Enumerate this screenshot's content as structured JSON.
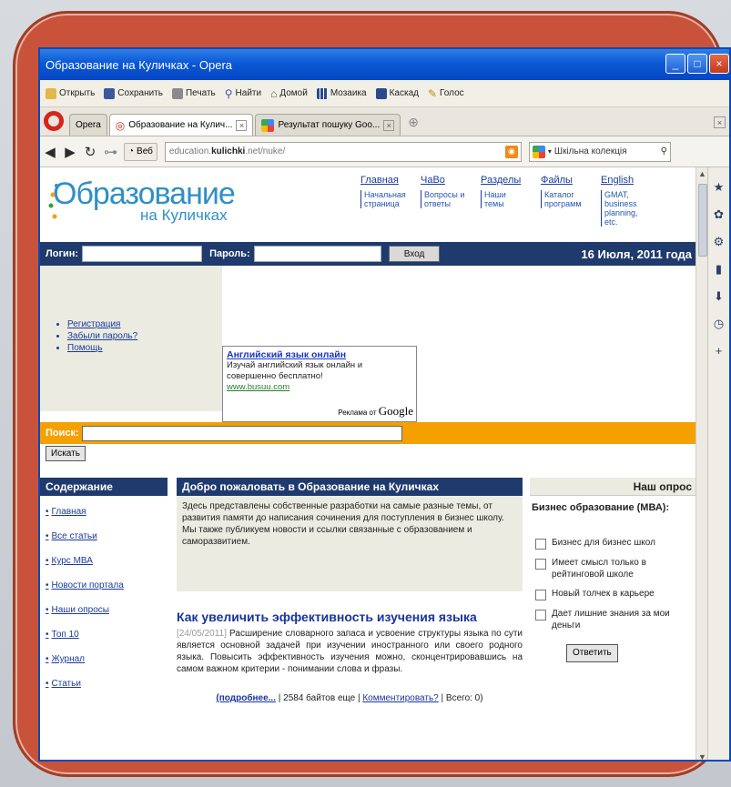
{
  "window": {
    "title": "Образование на Куличках - Opera",
    "buttons": [
      "_",
      "□",
      "×"
    ]
  },
  "toolbar": {
    "items": [
      "Открыть",
      "Сохранить",
      "Печать",
      "Найти",
      "Домой",
      "Мозаика",
      "Каскад",
      "Голос"
    ]
  },
  "tabs": {
    "opera_label": "Opera",
    "items": [
      {
        "label": "Образование на Кулич..."
      },
      {
        "label": "Результат пошуку Goo..."
      }
    ],
    "new_tab": "⊕"
  },
  "address": {
    "web_label": "Веб",
    "url_prefix": "education.",
    "url_domain": "kulichki",
    "url_suffix": ".net/nuke/",
    "search_value": "Шкільна колекція"
  },
  "header": {
    "logo_main": "Образование",
    "logo_sub": "на Куличках",
    "nav": [
      {
        "title": "Главная",
        "sub": "Начальная страница"
      },
      {
        "title": "ЧаВо",
        "sub": "Вопросы и ответы"
      },
      {
        "title": "Разделы",
        "sub": "Наши темы"
      },
      {
        "title": "Файлы",
        "sub": "Каталог программ"
      },
      {
        "title": "English",
        "sub": "GMAT, business planning, etc."
      }
    ]
  },
  "login": {
    "login_label": "Логин:",
    "password_label": "Пароль:",
    "enter_button": "Вход",
    "date": "16 Июля, 2011 года"
  },
  "account_links": [
    "Регистрация",
    "Забыли пароль?",
    "Помощь"
  ],
  "ad": {
    "title": "Английский язык онлайн",
    "body": "Изучай английский язык онлайн и совершенно бесплатно!",
    "link": "www.busuu.com",
    "by": "Реклама от",
    "brand": "Google"
  },
  "search": {
    "label": "Поиск:",
    "button": "Искать"
  },
  "contents": {
    "title": "Содержание",
    "items": [
      "Главная",
      "Все статьи",
      "Курс МВА",
      "Новости портала",
      "Наши опросы",
      "Топ 10",
      "Журнал",
      "Статьи"
    ]
  },
  "welcome": {
    "title": "Добро пожаловать в Образование на Куличках",
    "text1": "Здесь представлены собственные разработки на самые разные темы, от развития памяти до написания сочинения для поступления в бизнес школу.",
    "text2": "Мы также публикуем новости и ссылки связанные с образованием и саморазвитием."
  },
  "article": {
    "title": "Как увеличить эффективность изучения языка",
    "date": "[24/05/2011]",
    "body": "Расширение словарного запаса и усвоение структуры языка по сути является основной задачей при изучении иностранного или своего родного языка. Повысить эффективность изучения можно, сконцентрировавшись на самом важном критерии - понимании слова и фразы.",
    "more": "(подробнее...",
    "bytes": "| 2584 байтов еще |",
    "comment": "Комментировать?",
    "total": "| Всего: 0)"
  },
  "poll": {
    "title": "Наш опрос",
    "question": "Бизнес образование (МВА):",
    "options": [
      "Бизнес для бизнес школ",
      "Имеет смысл только в рейтинговой школе",
      "Новый толчек в карьере",
      "Дает лишние знания за мои деньги"
    ],
    "answer_button": "Ответить"
  }
}
